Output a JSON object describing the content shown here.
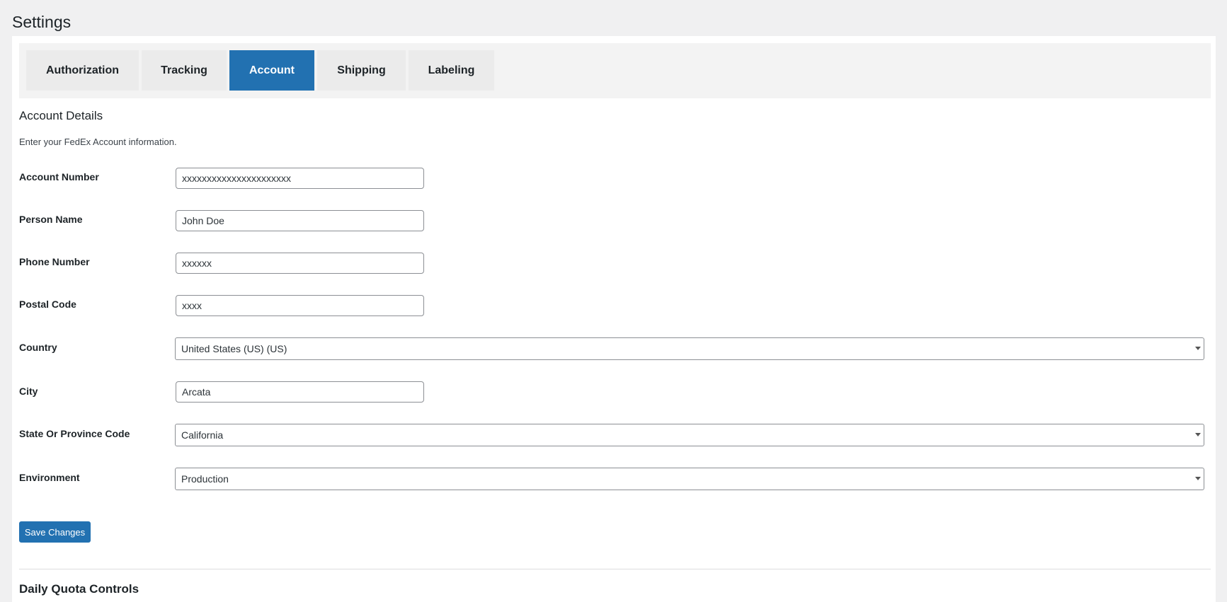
{
  "page": {
    "title": "Settings"
  },
  "tabs": [
    {
      "label": "Authorization",
      "active": false
    },
    {
      "label": "Tracking",
      "active": false
    },
    {
      "label": "Account",
      "active": true
    },
    {
      "label": "Shipping",
      "active": false
    },
    {
      "label": "Labeling",
      "active": false
    }
  ],
  "section": {
    "title": "Account Details",
    "description": "Enter your FedEx Account information."
  },
  "fields": {
    "account_number": {
      "label": "Account Number",
      "value": "xxxxxxxxxxxxxxxxxxxxxx"
    },
    "person_name": {
      "label": "Person Name",
      "value": "John Doe"
    },
    "phone_number": {
      "label": "Phone Number",
      "value": "xxxxxx"
    },
    "postal_code": {
      "label": "Postal Code",
      "value": "xxxx"
    },
    "country": {
      "label": "Country",
      "value": "United States (US) (US)"
    },
    "city": {
      "label": "City",
      "value": "Arcata"
    },
    "state": {
      "label": "State Or Province Code",
      "value": "California"
    },
    "environment": {
      "label": "Environment",
      "value": "Production"
    }
  },
  "actions": {
    "save_label": "Save Changes"
  },
  "next_section": {
    "title": "Daily Quota Controls"
  },
  "colors": {
    "accent": "#2271b1",
    "background": "#f0f0f1",
    "tab_inactive": "#ebebeb"
  },
  "icons": {
    "select_caret": "caret-down-icon"
  }
}
